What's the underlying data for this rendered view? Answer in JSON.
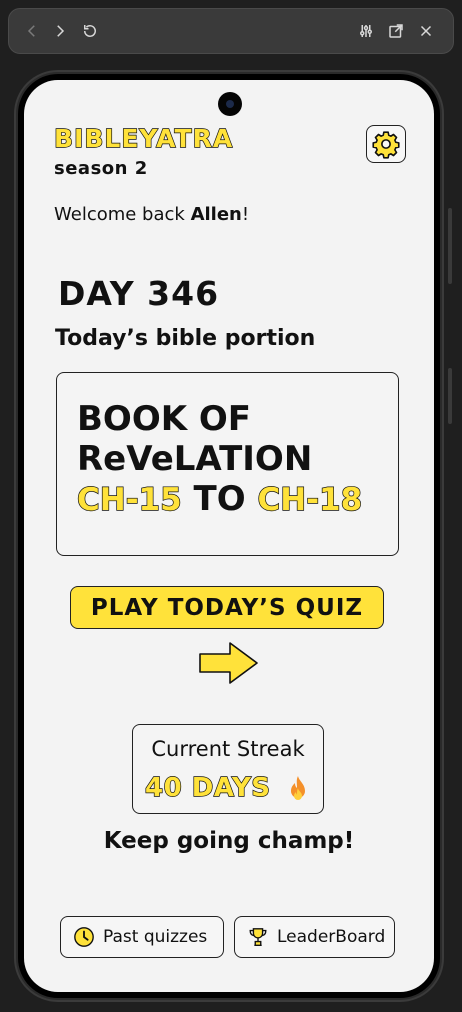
{
  "browser": {
    "icons": [
      "back-icon",
      "forward-icon",
      "reload-icon",
      "tune-icon",
      "open-external-icon",
      "close-icon"
    ]
  },
  "app": {
    "brand": "BIBLEYATRA",
    "season": "season 2",
    "welcome_prefix": "Welcome back ",
    "user_name": "Allen",
    "welcome_suffix": "!"
  },
  "today": {
    "day_label": "DAY 346",
    "portion_heading": "Today’s bible portion",
    "book_line1": "BOOK OF",
    "book_line2": "ReVeLATION",
    "chapter_from": "CH-15",
    "chapter_connector": "TO",
    "chapter_to": "CH-18"
  },
  "quiz": {
    "play_label": "PLAY TODAY’S QUIZ"
  },
  "streak": {
    "label": "Current Streak",
    "value": "40 DAYS",
    "message": "Keep going champ!"
  },
  "bottom_nav": {
    "past_label": "Past quizzes",
    "leader_label": "LeaderBoard"
  },
  "colors": {
    "accent": "#ffe23a",
    "background": "#f3f3f3",
    "ink": "#111111"
  }
}
